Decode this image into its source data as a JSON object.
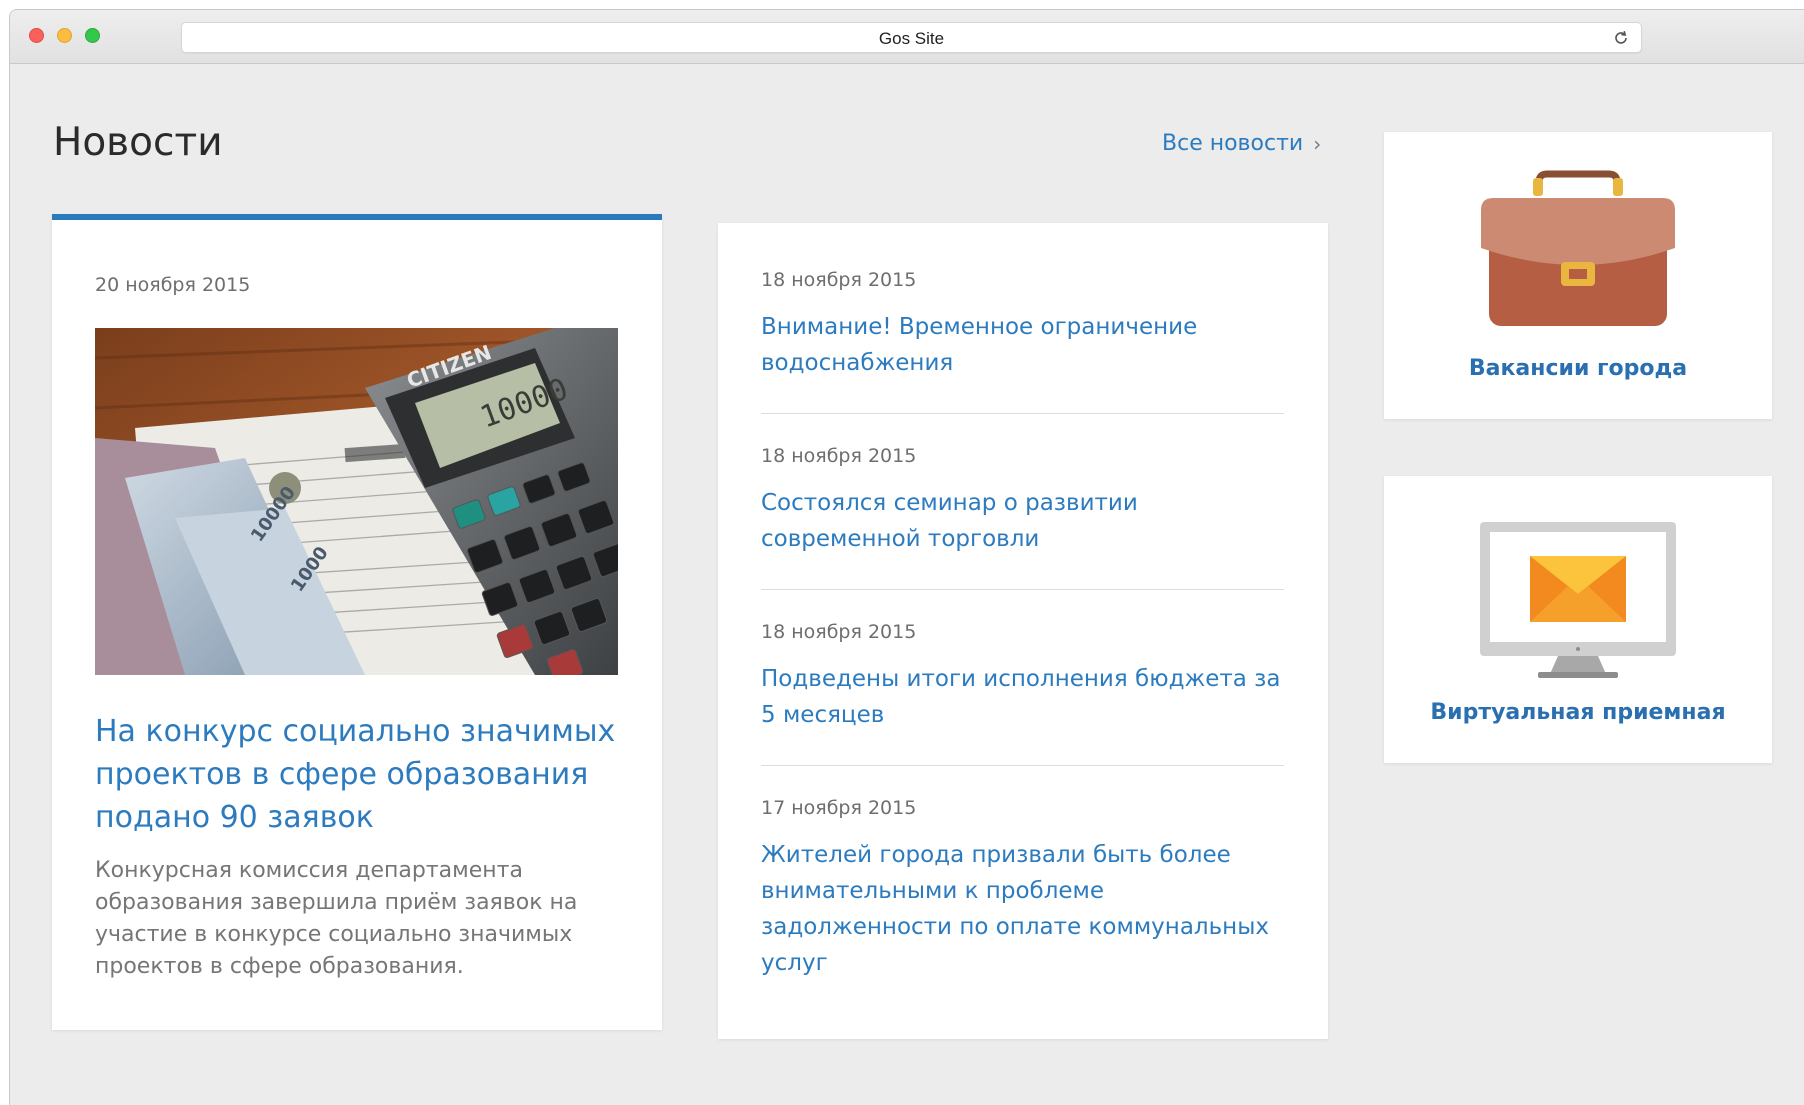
{
  "browser": {
    "page_title": "Gos Site"
  },
  "news_section": {
    "title": "Новости",
    "all_news_label": "Все новости"
  },
  "featured": {
    "date": "20 ноября 2015",
    "headline": "На конкурс социально значимых проектов в сфере образования подано 90 заявок",
    "lead": "Конкурсная комиссия департамента образования завершила приём заявок на участие в конкурсе социально значимых проектов в сфере образования.",
    "photo": {
      "brand": "CITIZEN",
      "display": "10000"
    }
  },
  "news_list": [
    {
      "date": "18 ноября 2015",
      "title": "Внимание! Временное ограничение водоснабжения"
    },
    {
      "date": "18 ноября 2015",
      "title": "Состоялся семинар о развитии современной торговли"
    },
    {
      "date": "18 ноября 2015",
      "title": "Подведены итоги исполнения бюджета за 5 месяцев"
    },
    {
      "date": "17 ноября 2015",
      "title": "Жителей города призвали быть более внимательными к проблеме задолженности по оплате коммунальных услуг"
    }
  ],
  "tiles": {
    "vacancies": {
      "label": "Вакансии города",
      "icon": "briefcase-icon"
    },
    "reception": {
      "label": "Виртуальная приемная",
      "icon": "monitor-envelope-icon"
    }
  },
  "colors": {
    "accent": "#2d7bbf",
    "featured_border": "#2a7bbd",
    "background": "#ececec"
  }
}
